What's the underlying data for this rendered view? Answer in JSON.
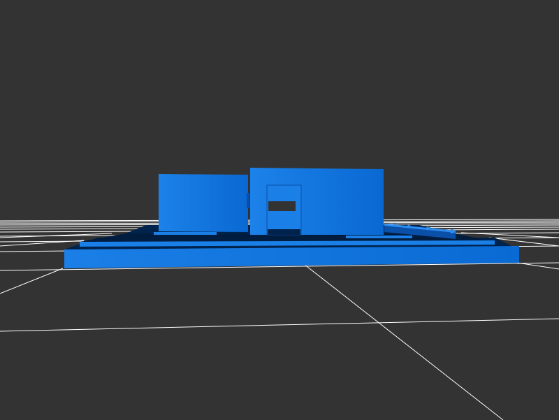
{
  "viewport": {
    "background_color": "#333333",
    "grid_color": "#ffffff"
  },
  "model": {
    "base_color": "#1a7fe6",
    "shadow_color": "#00234d",
    "dark_color": "#0a3a7a",
    "highlight_color": "#2e8df0",
    "mid_color": "#0f6fd8",
    "cutout_color": "#333333"
  }
}
